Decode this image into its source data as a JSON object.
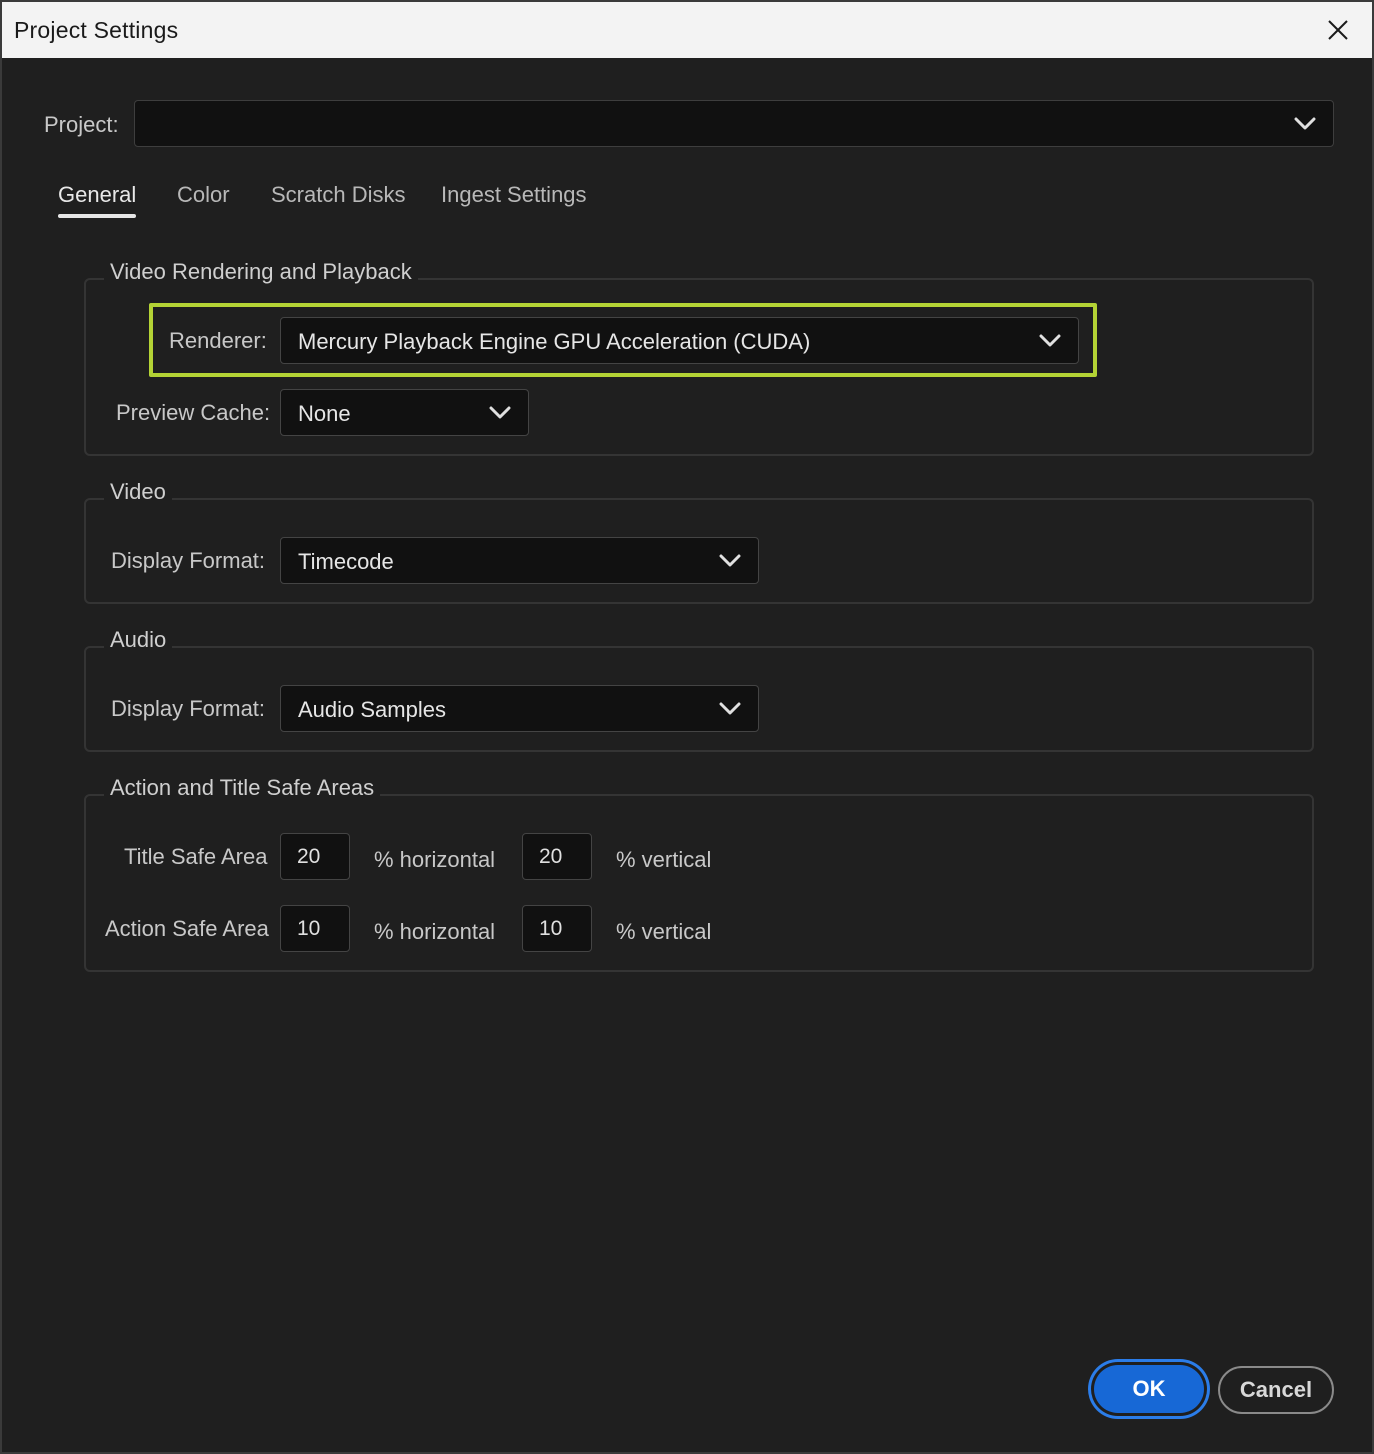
{
  "window": {
    "title": "Project Settings"
  },
  "project": {
    "label": "Project:",
    "value": ""
  },
  "tabs": [
    {
      "label": "General",
      "active": true
    },
    {
      "label": "Color",
      "active": false
    },
    {
      "label": "Scratch Disks",
      "active": false
    },
    {
      "label": "Ingest Settings",
      "active": false
    }
  ],
  "video_rendering": {
    "legend": "Video Rendering and Playback",
    "renderer_label": "Renderer:",
    "renderer_value": "Mercury Playback Engine GPU Acceleration (CUDA)",
    "preview_cache_label": "Preview Cache:",
    "preview_cache_value": "None"
  },
  "video": {
    "legend": "Video",
    "display_format_label": "Display Format:",
    "display_format_value": "Timecode"
  },
  "audio": {
    "legend": "Audio",
    "display_format_label": "Display Format:",
    "display_format_value": "Audio Samples"
  },
  "safe_areas": {
    "legend": "Action and Title Safe Areas",
    "title_label": "Title Safe Area",
    "title_horizontal": "20",
    "title_vertical": "20",
    "action_label": "Action Safe Area",
    "action_horizontal": "10",
    "action_vertical": "10",
    "horizontal_suffix": "% horizontal",
    "vertical_suffix": "% vertical"
  },
  "buttons": {
    "ok": "OK",
    "cancel": "Cancel"
  },
  "colors": {
    "highlight": "#b4d335",
    "ok_button": "#1768d6",
    "background": "#1f1f1f"
  },
  "icons": {
    "close": "close-icon",
    "dropdown": "chevron-down-icon"
  }
}
